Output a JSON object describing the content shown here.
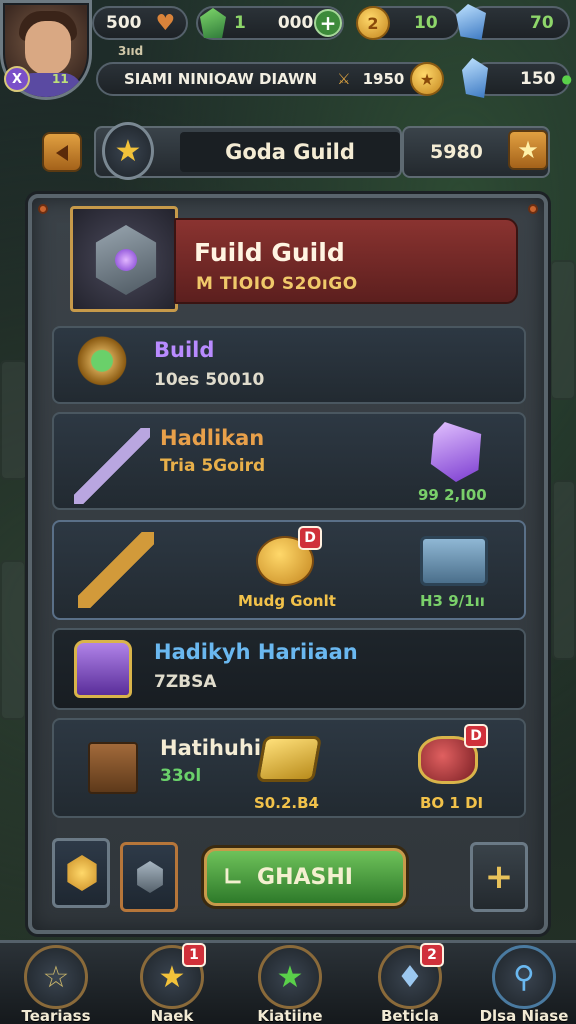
{
  "player": {
    "level": "X",
    "level_number": "11",
    "sub_label": "3ııd",
    "name_line": "SIAMI NINIOAW DIAWN",
    "name_value": "1950"
  },
  "resources": {
    "hearts": "500",
    "green_gems": "1",
    "green_gems_secondary": "000",
    "coins": "10",
    "blue_gems": "70",
    "blue_gems_secondary": "150"
  },
  "guild": {
    "title": "Goda Guild",
    "score": "5980"
  },
  "header": {
    "title": "Fuild Guild",
    "subtitle": "M TIOIO S2OıGO"
  },
  "rows": [
    {
      "title": "Build",
      "subtitle": "10es 50010",
      "title_color": "#b98bff"
    },
    {
      "title": "Hadlikan",
      "subtitle": "Tria 5Goird",
      "price": "99 2,I00",
      "title_color": "#e8a04a"
    },
    {
      "caption": "Mudg Gonlt",
      "badge": "D",
      "price": "H3 9/1ıı"
    },
    {
      "title": "Hadikyh Hariiaan",
      "subtitle": "7ZBSA",
      "title_color": "#6ab8f0"
    },
    {
      "title": "Hatihuhi",
      "subtitle": "33ol",
      "price_left": "S0.2.B4",
      "price_right": "BO 1 DI",
      "badge": "D"
    }
  ],
  "actions": {
    "claim_label": "GHASHI",
    "add_symbol": "+"
  },
  "nav": [
    {
      "label": "Teariass",
      "icon": "star-outline-icon"
    },
    {
      "label": "Naek",
      "icon": "gold-star-icon",
      "badge": "1"
    },
    {
      "label": "Kiatiine",
      "icon": "green-star-icon"
    },
    {
      "label": "Beticla",
      "icon": "blue-gem-icon",
      "badge": "2"
    },
    {
      "label": "Dlsa Niase",
      "icon": "magnifier-icon"
    }
  ],
  "colors": {
    "accent_gold": "#c79a4a",
    "price_green": "#7ad06a",
    "banner_red": "#8a3330"
  }
}
